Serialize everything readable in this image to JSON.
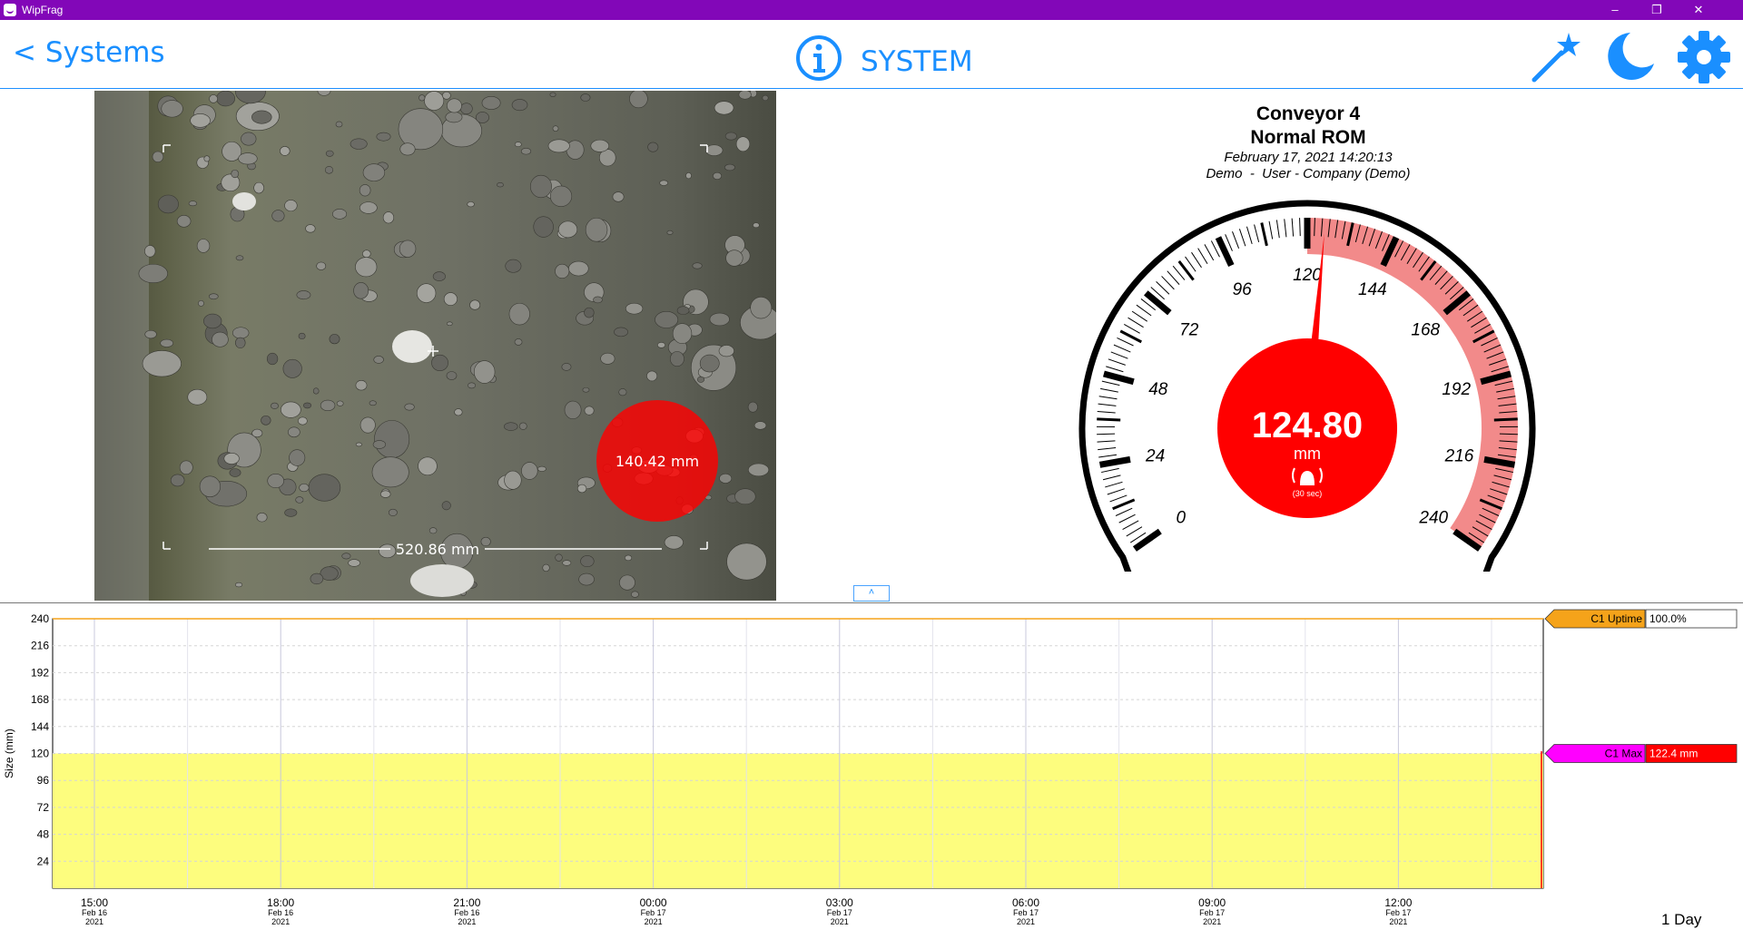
{
  "window": {
    "title": "WipFrag",
    "controls": [
      "–",
      "❐",
      "✕"
    ]
  },
  "header": {
    "back_label": "< Systems",
    "title": "SYSTEM",
    "icons": [
      "info-icon",
      "magic-wand-icon",
      "moon-icon",
      "gear-icon"
    ]
  },
  "camera": {
    "rock_size_label": "140.42 mm",
    "scale_label": "520.86 mm"
  },
  "gauge": {
    "line1": "Conveyor 4",
    "line2": "Normal ROM",
    "timestamp": "February 17, 2021 14:20:13",
    "user": "Demo  -  User - Company (Demo)",
    "value": 124.8,
    "value_label": "124.80",
    "unit": "mm",
    "alarm_label": "(30 sec)",
    "min": 0,
    "max": 240,
    "alarm_threshold": 120,
    "tick_labels": [
      "0",
      "24",
      "48",
      "72",
      "96",
      "120",
      "144",
      "168",
      "192",
      "216",
      "240"
    ],
    "colors": {
      "alarm_zone": "#f28a8a",
      "dial": "#ff0000"
    }
  },
  "collapse_label": "˄",
  "chart_data": {
    "type": "area",
    "ylabel": "Size (mm)",
    "ylim": [
      0,
      240
    ],
    "yticks": [
      "24",
      "48",
      "72",
      "96",
      "120",
      "144",
      "168",
      "192",
      "216",
      "240"
    ],
    "xticks": [
      {
        "time": "15:00",
        "date": "Feb 16",
        "year": "2021"
      },
      {
        "time": "18:00",
        "date": "Feb 16",
        "year": "2021"
      },
      {
        "time": "21:00",
        "date": "Feb 16",
        "year": "2021"
      },
      {
        "time": "00:00",
        "date": "Feb 17",
        "year": "2021"
      },
      {
        "time": "03:00",
        "date": "Feb 17",
        "year": "2021"
      },
      {
        "time": "06:00",
        "date": "Feb 17",
        "year": "2021"
      },
      {
        "time": "09:00",
        "date": "Feb 17",
        "year": "2021"
      },
      {
        "time": "12:00",
        "date": "Feb 17",
        "year": "2021"
      }
    ],
    "threshold_line": 240,
    "band": {
      "from": 0,
      "to": 120,
      "color": "#fdfd7e"
    },
    "markers": [
      {
        "label": "C1 Uptime",
        "value_label": "100.0%",
        "y": 240,
        "color": "#f5a31a",
        "value_bg": "#ffffff",
        "value_color": "#000000"
      },
      {
        "label": "C1 Max",
        "value_label": "122.4 mm",
        "y": 120,
        "color": "#ff00ff",
        "value_bg": "#ff0000",
        "value_color": "#ffffff"
      }
    ],
    "range_label": "1 Day"
  }
}
